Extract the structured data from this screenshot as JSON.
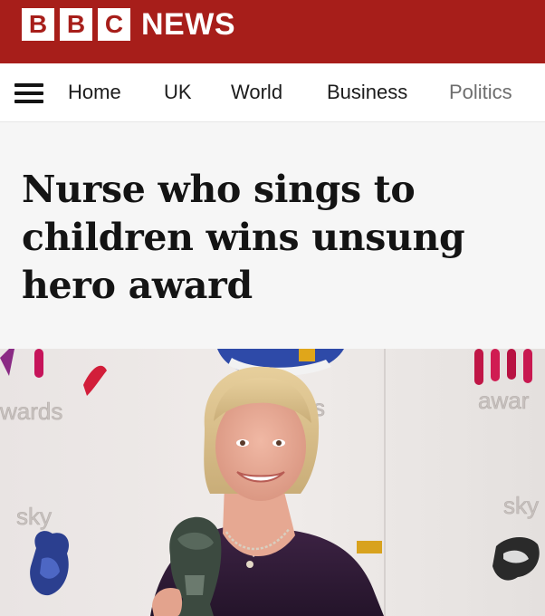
{
  "masthead": {
    "logo_letters": [
      "B",
      "B",
      "C"
    ],
    "logo_word": "NEWS",
    "brand_color": "#a71e1a"
  },
  "nav": {
    "menu_icon": "hamburger-menu-icon",
    "items": [
      "Home",
      "UK",
      "World",
      "Business",
      "Politics"
    ]
  },
  "article": {
    "headline": "Nurse who sings to children wins unsung hero award"
  },
  "hero": {
    "backdrop_text": {
      "left_awards": "wards",
      "center_awards": "s",
      "right_awards": "awar",
      "left_sky": "sky",
      "right_sky": "sky"
    }
  }
}
